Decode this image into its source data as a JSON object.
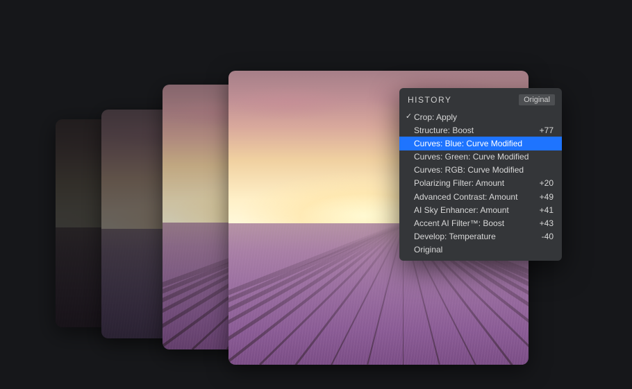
{
  "history": {
    "title": "HISTORY",
    "original_button": "Original",
    "items": [
      {
        "label": "Crop: Apply",
        "value": "",
        "checked": true,
        "selected": false
      },
      {
        "label": "Structure: Boost",
        "value": "+77",
        "checked": false,
        "selected": false
      },
      {
        "label": "Curves: Blue: Curve Modified",
        "value": "",
        "checked": false,
        "selected": true
      },
      {
        "label": "Curves: Green: Curve Modified",
        "value": "",
        "checked": false,
        "selected": false
      },
      {
        "label": "Curves: RGB: Curve Modified",
        "value": "",
        "checked": false,
        "selected": false
      },
      {
        "label": "Polarizing Filter: Amount",
        "value": "+20",
        "checked": false,
        "selected": false
      },
      {
        "label": "Advanced Contrast: Amount",
        "value": "+49",
        "checked": false,
        "selected": false
      },
      {
        "label": "AI Sky Enhancer: Amount",
        "value": "+41",
        "checked": false,
        "selected": false
      },
      {
        "label": "Accent AI Filter™: Boost",
        "value": "+43",
        "checked": false,
        "selected": false
      },
      {
        "label": "Develop: Temperature",
        "value": "-40",
        "checked": false,
        "selected": false
      },
      {
        "label": "Original",
        "value": "",
        "checked": false,
        "selected": false
      }
    ]
  }
}
